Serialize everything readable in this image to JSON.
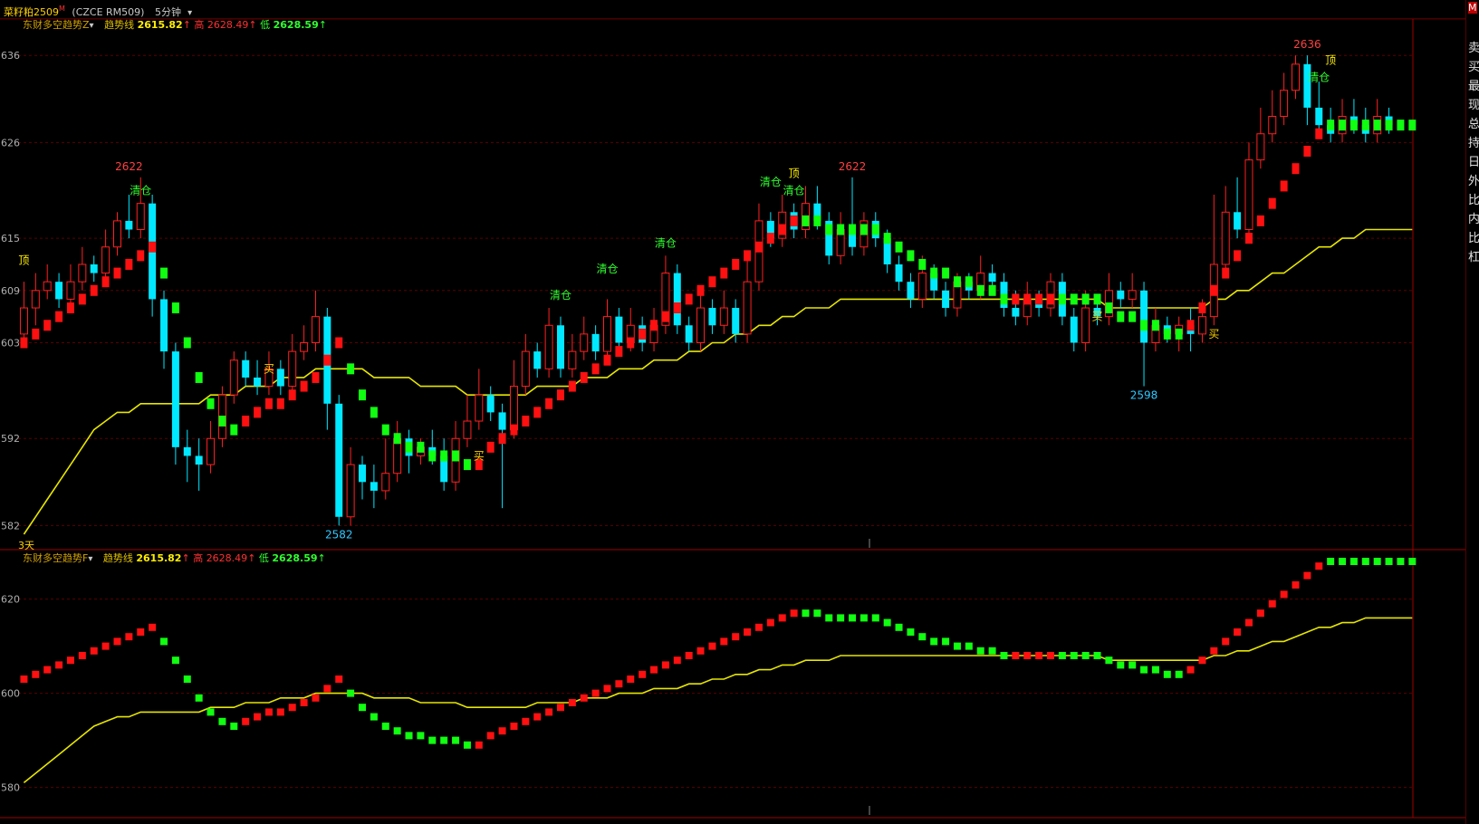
{
  "header": {
    "symbol": "菜籽粕2509",
    "superscript": "M",
    "code": "(CZCE RM509)",
    "period": "5分钟"
  },
  "legend_top": {
    "name": "东财多空趋势Z",
    "trend_label": "趋势线",
    "trend_value": "2615.82",
    "high_label": "高",
    "high_value": "2628.49",
    "low_label": "低",
    "low_value": "2628.59"
  },
  "legend_bottom": {
    "name": "东财多空趋势F",
    "trend_label": "趋势线",
    "trend_value": "2615.82",
    "high_label": "高",
    "high_value": "2628.49",
    "low_label": "低",
    "low_value": "2628.59"
  },
  "days_label": "3天",
  "right_panel": {
    "items": [
      "卖",
      "买",
      "最",
      "现",
      "总",
      "持",
      "日",
      "外",
      "比",
      "内",
      "比",
      "杠"
    ],
    "top_badge": "M"
  },
  "colors": {
    "up": "#ff2020",
    "down": "#00e8ff",
    "trend_up": "#ff1010",
    "trend_down": "#10ff10",
    "ma": "#e6e600",
    "grid": "#5a0000",
    "axis": "#b0b0b0"
  },
  "chart_data": [
    {
      "type": "candlestick",
      "panel": "main",
      "y_ticks": [
        "2636",
        "2626",
        "2615",
        "2609",
        "2603",
        "2592",
        "2582"
      ],
      "ylim": [
        2581,
        2638
      ],
      "annotations": [
        {
          "text": "2622",
          "kind": "high",
          "x": 9,
          "y": 2622
        },
        {
          "text": "2582",
          "kind": "low",
          "x": 27,
          "y": 2582
        },
        {
          "text": "2622",
          "kind": "high",
          "x": 71,
          "y": 2622
        },
        {
          "text": "2598",
          "kind": "low",
          "x": 96,
          "y": 2598
        },
        {
          "text": "2636",
          "kind": "high",
          "x": 110,
          "y": 2636
        },
        {
          "text": "顶",
          "kind": "top",
          "x": 0,
          "y": 2611
        },
        {
          "text": "清仓",
          "kind": "clear",
          "x": 10,
          "y": 2619
        },
        {
          "text": "买",
          "kind": "buy",
          "x": 21,
          "y": 2600
        },
        {
          "text": "买",
          "kind": "buy",
          "x": 39,
          "y": 2590
        },
        {
          "text": "清仓",
          "kind": "clear",
          "x": 46,
          "y": 2607
        },
        {
          "text": "清仓",
          "kind": "clear",
          "x": 50,
          "y": 2610
        },
        {
          "text": "清仓",
          "kind": "clear",
          "x": 55,
          "y": 2613
        },
        {
          "text": "清仓",
          "kind": "clear",
          "x": 64,
          "y": 2620
        },
        {
          "text": "清仓",
          "kind": "clear",
          "x": 66,
          "y": 2619
        },
        {
          "text": "顶",
          "kind": "top",
          "x": 66,
          "y": 2621
        },
        {
          "text": "买",
          "kind": "buy",
          "x": 92,
          "y": 2606
        },
        {
          "text": "买",
          "kind": "buy",
          "x": 102,
          "y": 2604
        },
        {
          "text": "清仓",
          "kind": "clear",
          "x": 111,
          "y": 2632
        },
        {
          "text": "顶",
          "kind": "top",
          "x": 112,
          "y": 2634
        }
      ],
      "candles": [
        [
          2604,
          2607,
          2603,
          2610
        ],
        [
          2607,
          2609,
          2605,
          2611
        ],
        [
          2609,
          2610,
          2608,
          2612
        ],
        [
          2610,
          2608,
          2607,
          2611
        ],
        [
          2608,
          2610,
          2607,
          2612
        ],
        [
          2610,
          2612,
          2609,
          2614
        ],
        [
          2612,
          2611,
          2610,
          2613
        ],
        [
          2611,
          2614,
          2610,
          2616
        ],
        [
          2614,
          2617,
          2613,
          2618
        ],
        [
          2617,
          2616,
          2615,
          2620
        ],
        [
          2616,
          2619,
          2615,
          2622
        ],
        [
          2619,
          2608,
          2606,
          2620
        ],
        [
          2608,
          2602,
          2600,
          2609
        ],
        [
          2602,
          2591,
          2589,
          2603
        ],
        [
          2591,
          2590,
          2587,
          2593
        ],
        [
          2590,
          2589,
          2586,
          2592
        ],
        [
          2589,
          2592,
          2588,
          2594
        ],
        [
          2592,
          2597,
          2591,
          2598
        ],
        [
          2597,
          2601,
          2596,
          2602
        ],
        [
          2601,
          2599,
          2598,
          2602
        ],
        [
          2599,
          2598,
          2597,
          2601
        ],
        [
          2598,
          2600,
          2597,
          2602
        ],
        [
          2600,
          2598,
          2597,
          2601
        ],
        [
          2598,
          2602,
          2597,
          2604
        ],
        [
          2602,
          2603,
          2601,
          2605
        ],
        [
          2603,
          2606,
          2602,
          2609
        ],
        [
          2606,
          2596,
          2593,
          2607
        ],
        [
          2596,
          2583,
          2582,
          2597
        ],
        [
          2583,
          2589,
          2582,
          2591
        ],
        [
          2589,
          2587,
          2585,
          2590
        ],
        [
          2587,
          2586,
          2584,
          2589
        ],
        [
          2586,
          2588,
          2585,
          2592
        ],
        [
          2588,
          2592,
          2587,
          2594
        ],
        [
          2592,
          2590,
          2588,
          2593
        ],
        [
          2590,
          2591,
          2589,
          2592
        ],
        [
          2591,
          2590,
          2589,
          2593
        ],
        [
          2590,
          2587,
          2586,
          2592
        ],
        [
          2587,
          2592,
          2586,
          2594
        ],
        [
          2592,
          2594,
          2591,
          2597
        ],
        [
          2594,
          2597,
          2593,
          2600
        ],
        [
          2597,
          2595,
          2594,
          2598
        ],
        [
          2595,
          2593,
          2584,
          2596
        ],
        [
          2593,
          2598,
          2592,
          2601
        ],
        [
          2598,
          2602,
          2597,
          2604
        ],
        [
          2602,
          2600,
          2599,
          2603
        ],
        [
          2600,
          2605,
          2599,
          2607
        ],
        [
          2605,
          2600,
          2599,
          2606
        ],
        [
          2600,
          2602,
          2599,
          2604
        ],
        [
          2602,
          2604,
          2601,
          2606
        ],
        [
          2604,
          2602,
          2601,
          2605
        ],
        [
          2602,
          2606,
          2601,
          2608
        ],
        [
          2606,
          2603,
          2602,
          2607
        ],
        [
          2603,
          2605,
          2602,
          2607
        ],
        [
          2605,
          2603,
          2602,
          2606
        ],
        [
          2603,
          2605,
          2602,
          2607
        ],
        [
          2605,
          2611,
          2604,
          2613
        ],
        [
          2611,
          2605,
          2604,
          2612
        ],
        [
          2605,
          2603,
          2602,
          2606
        ],
        [
          2603,
          2607,
          2602,
          2609
        ],
        [
          2607,
          2605,
          2604,
          2608
        ],
        [
          2605,
          2607,
          2604,
          2609
        ],
        [
          2607,
          2604,
          2603,
          2608
        ],
        [
          2604,
          2610,
          2603,
          2613
        ],
        [
          2610,
          2617,
          2609,
          2619
        ],
        [
          2617,
          2615,
          2614,
          2618
        ],
        [
          2615,
          2618,
          2614,
          2620
        ],
        [
          2618,
          2616,
          2615,
          2619
        ],
        [
          2616,
          2619,
          2615,
          2621
        ],
        [
          2619,
          2617,
          2616,
          2621
        ],
        [
          2617,
          2613,
          2612,
          2618
        ],
        [
          2613,
          2616,
          2612,
          2618
        ],
        [
          2616,
          2614,
          2613,
          2622
        ],
        [
          2614,
          2617,
          2613,
          2618
        ],
        [
          2617,
          2615,
          2614,
          2618
        ],
        [
          2615,
          2612,
          2611,
          2616
        ],
        [
          2612,
          2610,
          2609,
          2613
        ],
        [
          2610,
          2608,
          2607,
          2611
        ],
        [
          2608,
          2611,
          2607,
          2613
        ],
        [
          2611,
          2609,
          2608,
          2612
        ],
        [
          2609,
          2607,
          2606,
          2610
        ],
        [
          2607,
          2610,
          2606,
          2611
        ],
        [
          2610,
          2609,
          2608,
          2611
        ],
        [
          2609,
          2611,
          2608,
          2613
        ],
        [
          2611,
          2610,
          2609,
          2612
        ],
        [
          2610,
          2607,
          2606,
          2611
        ],
        [
          2607,
          2606,
          2605,
          2609
        ],
        [
          2606,
          2608,
          2605,
          2610
        ],
        [
          2608,
          2607,
          2606,
          2609
        ],
        [
          2607,
          2610,
          2606,
          2611
        ],
        [
          2610,
          2606,
          2605,
          2611
        ],
        [
          2606,
          2603,
          2602,
          2607
        ],
        [
          2603,
          2607,
          2602,
          2609
        ],
        [
          2607,
          2606,
          2605,
          2608
        ],
        [
          2606,
          2609,
          2605,
          2611
        ],
        [
          2609,
          2608,
          2607,
          2610
        ],
        [
          2608,
          2609,
          2607,
          2611
        ],
        [
          2609,
          2603,
          2598,
          2610
        ],
        [
          2603,
          2605,
          2602,
          2607
        ],
        [
          2605,
          2604,
          2603,
          2606
        ],
        [
          2604,
          2605,
          2602,
          2606
        ],
        [
          2605,
          2604,
          2602,
          2607
        ],
        [
          2604,
          2606,
          2603,
          2608
        ],
        [
          2606,
          2612,
          2605,
          2620
        ],
        [
          2612,
          2618,
          2611,
          2621
        ],
        [
          2618,
          2616,
          2615,
          2622
        ],
        [
          2616,
          2624,
          2615,
          2626
        ],
        [
          2624,
          2627,
          2623,
          2630
        ],
        [
          2627,
          2629,
          2626,
          2632
        ],
        [
          2629,
          2632,
          2628,
          2634
        ],
        [
          2632,
          2635,
          2631,
          2636
        ],
        [
          2635,
          2630,
          2628,
          2636
        ],
        [
          2630,
          2628,
          2627,
          2633
        ],
        [
          2628,
          2627,
          2626,
          2630
        ],
        [
          2627,
          2629,
          2626,
          2631
        ],
        [
          2629,
          2628,
          2627,
          2631
        ],
        [
          2628,
          2627,
          2626,
          2630
        ],
        [
          2627,
          2629,
          2626,
          2631
        ],
        [
          2629,
          2628,
          2627,
          2630
        ]
      ],
      "trend": [
        2603,
        2604,
        2605,
        2606,
        2607,
        2608,
        2609,
        2610,
        2611,
        2612,
        2613,
        2614,
        2611,
        2607,
        2603,
        2599,
        2596,
        2594,
        2593,
        2594,
        2595,
        2596,
        2596,
        2597,
        2598,
        2599,
        2601,
        2603,
        2600,
        2597,
        2595,
        2593,
        2592,
        2591,
        2591,
        2590,
        2590,
        2590,
        2589,
        2589,
        2591,
        2592,
        2593,
        2594,
        2595,
        2596,
        2597,
        2598,
        2599,
        2600,
        2601,
        2602,
        2603,
        2604,
        2605,
        2606,
        2607,
        2608,
        2609,
        2610,
        2611,
        2612,
        2613,
        2614,
        2615,
        2616,
        2617,
        2617,
        2617,
        2616,
        2616,
        2616,
        2616,
        2616,
        2615,
        2614,
        2613,
        2612,
        2611,
        2611,
        2610,
        2610,
        2609,
        2609,
        2608,
        2608,
        2608,
        2608,
        2608,
        2608,
        2608,
        2608,
        2608,
        2607,
        2606,
        2606,
        2605,
        2605,
        2604,
        2604,
        2605,
        2607,
        2609,
        2611,
        2613,
        2615,
        2617,
        2619,
        2621,
        2623,
        2625,
        2627,
        2628,
        2628,
        2628,
        2628,
        2628,
        2628,
        2628,
        2628
      ],
      "trend_dir": [
        "u",
        "u",
        "u",
        "u",
        "u",
        "u",
        "u",
        "u",
        "u",
        "u",
        "u",
        "u",
        "d",
        "d",
        "d",
        "d",
        "d",
        "d",
        "d",
        "u",
        "u",
        "u",
        "u",
        "u",
        "u",
        "u",
        "u",
        "u",
        "d",
        "d",
        "d",
        "d",
        "d",
        "d",
        "d",
        "d",
        "d",
        "d",
        "d",
        "u",
        "u",
        "u",
        "u",
        "u",
        "u",
        "u",
        "u",
        "u",
        "u",
        "u",
        "u",
        "u",
        "u",
        "u",
        "u",
        "u",
        "u",
        "u",
        "u",
        "u",
        "u",
        "u",
        "u",
        "u",
        "u",
        "u",
        "u",
        "d",
        "d",
        "d",
        "d",
        "d",
        "d",
        "d",
        "d",
        "d",
        "d",
        "d",
        "d",
        "d",
        "d",
        "d",
        "d",
        "d",
        "d",
        "u",
        "u",
        "u",
        "u",
        "d",
        "d",
        "d",
        "d",
        "d",
        "d",
        "d",
        "d",
        "d",
        "d",
        "d",
        "u",
        "u",
        "u",
        "u",
        "u",
        "u",
        "u",
        "u",
        "u",
        "u",
        "u",
        "u",
        "d",
        "d",
        "d",
        "d",
        "d",
        "d",
        "d",
        "d"
      ],
      "ma": [
        2581,
        2583,
        2585,
        2587,
        2589,
        2591,
        2593,
        2594,
        2595,
        2595,
        2596,
        2596,
        2596,
        2596,
        2596,
        2596,
        2597,
        2597,
        2597,
        2598,
        2598,
        2598,
        2599,
        2599,
        2599,
        2600,
        2600,
        2600,
        2600,
        2600,
        2599,
        2599,
        2599,
        2599,
        2598,
        2598,
        2598,
        2598,
        2597,
        2597,
        2597,
        2597,
        2597,
        2597,
        2598,
        2598,
        2598,
        2598,
        2599,
        2599,
        2599,
        2600,
        2600,
        2600,
        2601,
        2601,
        2601,
        2602,
        2602,
        2603,
        2603,
        2604,
        2604,
        2605,
        2605,
        2606,
        2606,
        2607,
        2607,
        2607,
        2608,
        2608,
        2608,
        2608,
        2608,
        2608,
        2608,
        2608,
        2608,
        2608,
        2608,
        2608,
        2608,
        2608,
        2608,
        2608,
        2608,
        2608,
        2608,
        2608,
        2608,
        2608,
        2608,
        2607,
        2607,
        2607,
        2607,
        2607,
        2607,
        2607,
        2607,
        2607,
        2608,
        2608,
        2609,
        2609,
        2610,
        2611,
        2611,
        2612,
        2613,
        2614,
        2614,
        2615,
        2615,
        2616,
        2616,
        2616,
        2616,
        2616
      ]
    },
    {
      "type": "line",
      "panel": "indicator",
      "y_ticks": [
        "2620",
        "2600",
        "2580"
      ],
      "ylim": [
        2578,
        2628
      ]
    }
  ]
}
